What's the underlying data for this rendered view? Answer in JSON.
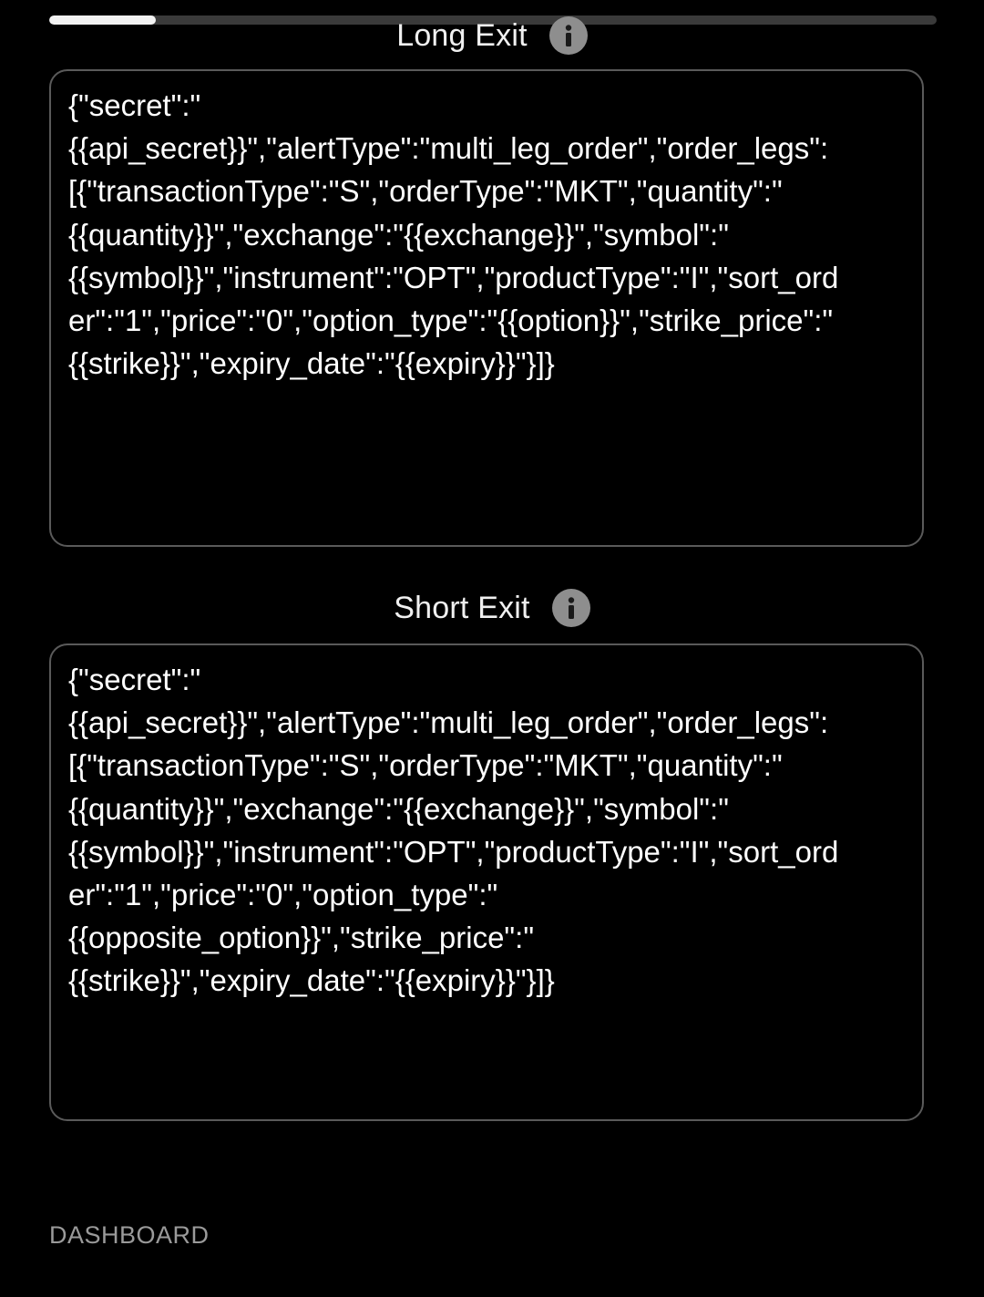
{
  "scroll_indicator": {
    "progress": 0.12
  },
  "long_exit": {
    "label": "Long Exit",
    "info_icon": "info-icon",
    "payload": "{\"secret\":\"\n{{api_secret}}\",\"alertType\":\"multi_leg_order\",\"order_legs\":\n[{\"transactionType\":\"S\",\"orderType\":\"MKT\",\"quantity\":\"\n{{quantity}}\",\"exchange\":\"{{exchange}}\",\"symbol\":\"\n{{symbol}}\",\"instrument\":\"OPT\",\"productType\":\"I\",\"sort_ord\ner\":\"1\",\"price\":\"0\",\"option_type\":\"{{option}}\",\"strike_price\":\"\n{{strike}}\",\"expiry_date\":\"{{expiry}}\"}]}"
  },
  "short_exit": {
    "label": "Short Exit",
    "info_icon": "info-icon",
    "payload": "{\"secret\":\"\n{{api_secret}}\",\"alertType\":\"multi_leg_order\",\"order_legs\":\n[{\"transactionType\":\"S\",\"orderType\":\"MKT\",\"quantity\":\"\n{{quantity}}\",\"exchange\":\"{{exchange}}\",\"symbol\":\"\n{{symbol}}\",\"instrument\":\"OPT\",\"productType\":\"I\",\"sort_ord\ner\":\"1\",\"price\":\"0\",\"option_type\":\"\n{{opposite_option}}\",\"strike_price\":\"\n{{strike}}\",\"expiry_date\":\"{{expiry}}\"}]}"
  },
  "footer": {
    "dashboard_label": "DASHBOARD"
  },
  "colors": {
    "background": "#000000",
    "text": "#ffffff",
    "border": "#5a5a5a",
    "icon": "#8e8e8e",
    "muted": "#9a9a9a"
  }
}
